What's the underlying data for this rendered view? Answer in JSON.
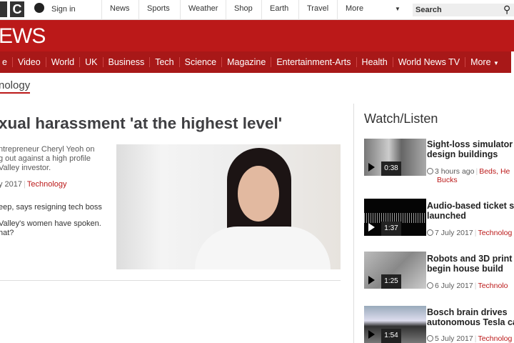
{
  "top": {
    "logo_letter": "C",
    "sign_in": "Sign in",
    "nav": [
      "News",
      "Sports",
      "Weather",
      "Shop",
      "Earth",
      "Travel",
      "More"
    ],
    "search_placeholder": "Search"
  },
  "brand": "EWS",
  "nav": [
    "e",
    "Video",
    "World",
    "UK",
    "Business",
    "Tech",
    "Science",
    "Magazine",
    "Entertainment-Arts",
    "Health",
    "World News TV",
    "More"
  ],
  "section": "nology",
  "story": {
    "headline": "xual harassment 'at the highest level'",
    "summary": [
      "ntrepreneur Cheryl Yeoh on",
      "g out against a high profile",
      "Valley investor."
    ],
    "date": "y 2017",
    "tag": "Technology",
    "related": [
      "eep, says resigning tech boss",
      "Valley's women have spoken.",
      "hat?"
    ]
  },
  "watch": {
    "title": "Watch/Listen",
    "items": [
      {
        "title1": "Sight-loss simulator",
        "title2": "design buildings",
        "duration": "0:38",
        "time": "3 hours ago",
        "tag": "Beds, He",
        "tag2": "Bucks"
      },
      {
        "title1": "Audio-based ticket s",
        "title2": "launched",
        "duration": "1:37",
        "time": "7 July 2017",
        "tag": "Technolog"
      },
      {
        "title1": "Robots and 3D print",
        "title2": "begin house build",
        "duration": "1:25",
        "time": "6 July 2017",
        "tag": "Technolo"
      },
      {
        "title1": "Bosch brain drives",
        "title2": "autonomous Tesla ca",
        "duration": "1:54",
        "time": "5 July 2017",
        "tag": "Technolog"
      }
    ]
  },
  "colors": {
    "brand_red": "#bb1919",
    "nav_red": "#a81818"
  }
}
